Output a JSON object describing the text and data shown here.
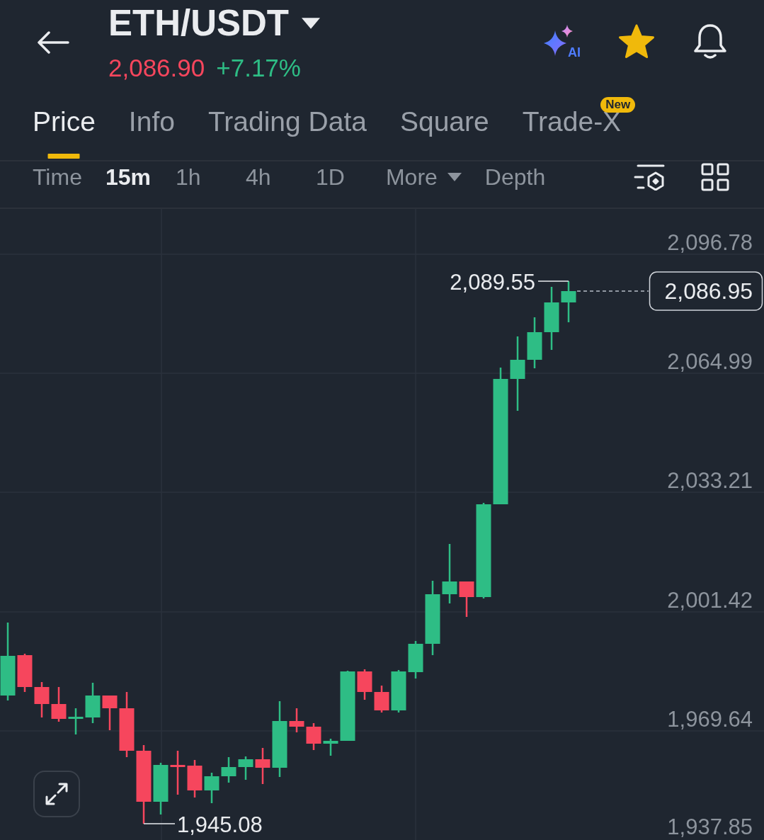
{
  "header": {
    "pair": "ETH/USDT",
    "last_price": "2,086.90",
    "price_change": "+7.17%",
    "ai_label": "AI",
    "favorite": true
  },
  "tabs": [
    {
      "label": "Price",
      "selected": true
    },
    {
      "label": "Info",
      "selected": false
    },
    {
      "label": "Trading Data",
      "selected": false
    },
    {
      "label": "Square",
      "selected": false
    },
    {
      "label": "Trade-X",
      "selected": false,
      "badge": "New"
    }
  ],
  "intervals": [
    {
      "label": "Time",
      "selected": false,
      "kind": "option"
    },
    {
      "label": "15m",
      "selected": true,
      "kind": "option"
    },
    {
      "label": "1h",
      "selected": false,
      "kind": "option"
    },
    {
      "label": "4h",
      "selected": false,
      "kind": "option"
    },
    {
      "label": "1D",
      "selected": false,
      "kind": "option"
    },
    {
      "label": "More",
      "selected": false,
      "kind": "dropdown"
    },
    {
      "label": "Depth",
      "selected": false,
      "kind": "option"
    }
  ],
  "chart": {
    "price_axis": [
      "2,096.78",
      "2,064.99",
      "2,033.21",
      "2,001.42",
      "1,969.64",
      "1,937.85"
    ],
    "high_label": "2,089.55",
    "low_label": "1,945.08",
    "current_price": "2,086.95"
  }
}
